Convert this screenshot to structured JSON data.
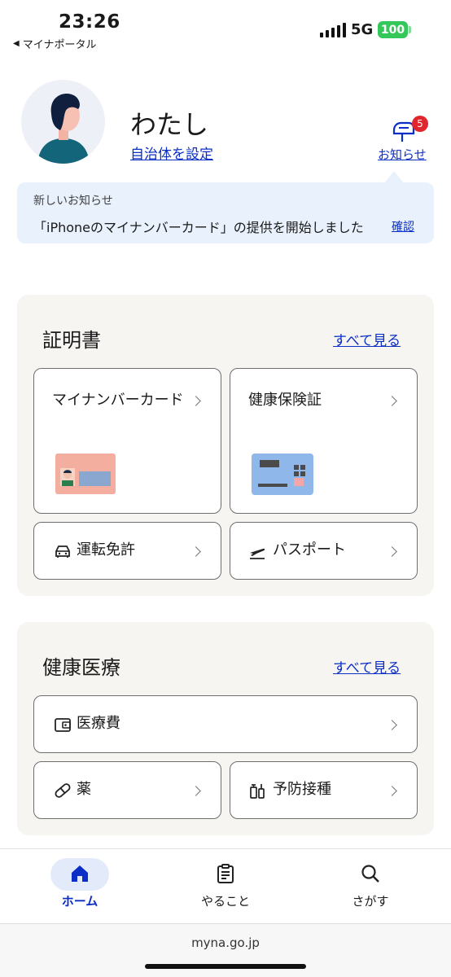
{
  "status_bar": {
    "time": "23:26",
    "back_app": "マイナポータル",
    "network": "5G",
    "battery": "100"
  },
  "profile": {
    "name": "わたし",
    "set_municipality": "自治体を設定",
    "notifications_label": "お知らせ",
    "notifications_count": "5"
  },
  "notice": {
    "title": "新しいお知らせ",
    "text": "「iPhoneのマイナンバーカード」の提供を開始しました",
    "confirm": "確認"
  },
  "certificates": {
    "title": "証明書",
    "see_all": "すべて見る",
    "cards": [
      {
        "label": "マイナンバーカード"
      },
      {
        "label": "健康保険証"
      },
      {
        "label": "運転免許"
      },
      {
        "label": "パスポート"
      }
    ]
  },
  "health": {
    "title": "健康医療",
    "see_all": "すべて見る",
    "rows": [
      {
        "label": "医療費"
      },
      {
        "label": "薬"
      },
      {
        "label": "予防接種"
      }
    ]
  },
  "tabbar": {
    "items": [
      {
        "label": "ホーム",
        "icon": "home-icon",
        "active": true
      },
      {
        "label": "やること",
        "icon": "clipboard-icon"
      },
      {
        "label": "さがす",
        "icon": "search-icon"
      }
    ]
  },
  "browser": {
    "url": "myna.go.jp"
  },
  "colors": {
    "link": "#0a2ec6",
    "panel_bg": "#f7f5f1",
    "notice_bg": "#e8f1fc",
    "badge": "#e0262c",
    "battery": "#34c759"
  }
}
